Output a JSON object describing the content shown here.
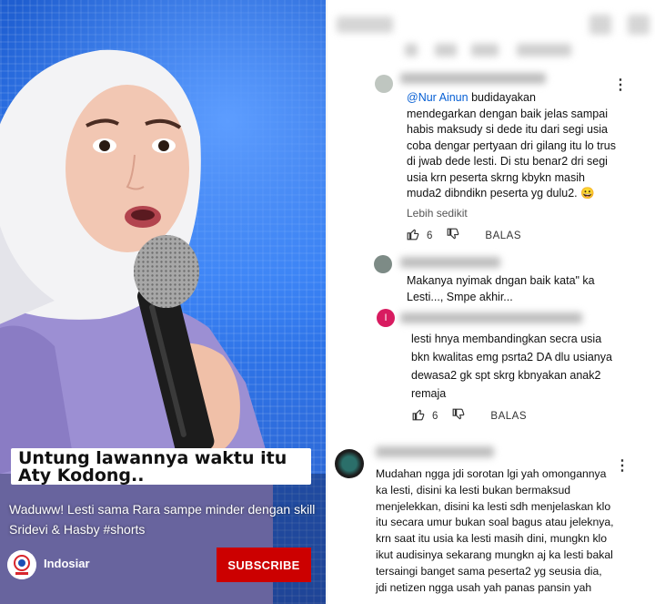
{
  "video": {
    "caption": "Untung lawannya waktu itu Aty Kodong..",
    "title": "Waduww! Lesti sama Rara sampe minder dengan skill Sridevi & Hasby #shorts",
    "channel": "Indosiar",
    "subscribe_label": "SUBSCRIBE",
    "bg_color": "#2d6fd9",
    "subscribe_color": "#cc0000"
  },
  "comments": [
    {
      "mention": "@Nur Ainun",
      "text_first": " budidayakan",
      "text_rest": "mendegarkan dengan baik jelas sampai habis maksudy si dede itu dari segi usia coba dengar pertyaan dri gilang itu lo trus di jwab dede lesti.  Di stu benar2 dri segi usia krn peserta skrng kbykn masih muda2 dibndikn peserta yg dulu2. 😀",
      "more": "Lebih sedikit",
      "likes": "6",
      "reply": "BALAS"
    },
    {
      "text": "Makanya nyimak dngan baik kata\" ka Lesti..., Smpe akhir..."
    },
    {
      "avatar_letter": "I",
      "text": "lesti hnya membandingkan secra usia bkn kwalitas emg psrta2 DA dlu usianya dewasa2 gk spt skrg kbnyakan anak2 remaja",
      "likes": "6",
      "reply": "BALAS"
    },
    {
      "text": "Mudahan ngga jdi sorotan lgi yah omongannya ka lesti, disini ka lesti bukan bermaksud menjelekkan, disini ka lesti sdh menjelaskan klo itu secara umur bukan soal bagus atau jeleknya, krn saat itu usia ka lesti masih dini, mungkn klo ikut audisinya sekarang mungkn aj ka lesti bakal tersaingi banget sama peserta2 yg seusia dia, jdi netizen ngga usah yah panas pansin yah"
    }
  ],
  "icons": {
    "like": "thumbs-up-icon",
    "dislike": "thumbs-down-icon",
    "menu": "more-vert-icon"
  }
}
